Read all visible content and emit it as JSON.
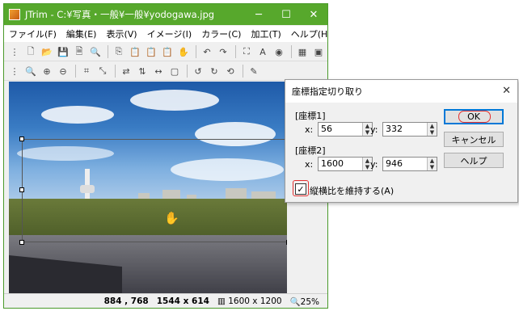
{
  "window": {
    "title": "JTrim - C:¥写真・一般¥一般¥yodogawa.jpg",
    "minimize_icon": "minimize-icon",
    "maximize_icon": "maximize-icon",
    "close_icon": "close-icon"
  },
  "menu": {
    "items": [
      "ファイル(F)",
      "編集(E)",
      "表示(V)",
      "イメージ(I)",
      "カラー(C)",
      "加工(T)",
      "ヘルプ(H)"
    ]
  },
  "status": {
    "coords": "884 , 768",
    "selection": "1544 x 614",
    "image_size": "1600 x 1200",
    "zoom": "25%"
  },
  "dialog": {
    "title": "座標指定切り取り",
    "group1": "[座標1]",
    "group2": "[座標2]",
    "x_label": "x:",
    "y_label": "y:",
    "x1": "56",
    "y1": "332",
    "x2": "1600",
    "y2": "946",
    "ok": "OK",
    "cancel": "キャンセル",
    "help": "ヘルプ",
    "keep_ratio": "縦横比を維持する(A)",
    "keep_ratio_checked": true
  }
}
